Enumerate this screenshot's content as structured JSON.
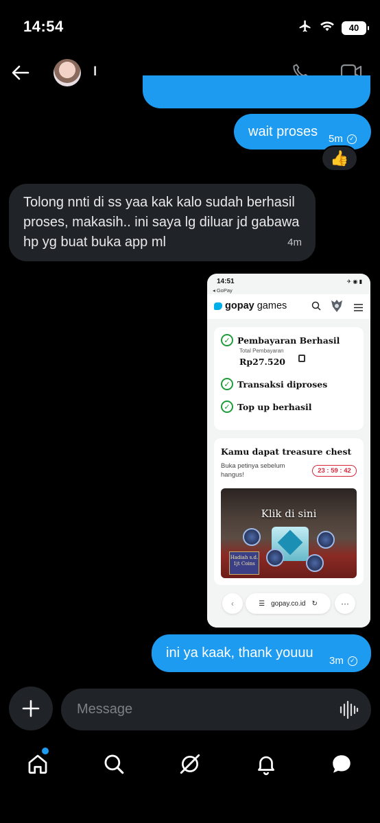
{
  "status_bar": {
    "time": "14:54",
    "battery": "40"
  },
  "header": {
    "contact_name": "I"
  },
  "messages": [
    {
      "direction": "out",
      "text": "wait proses",
      "time": "5m",
      "reaction": "👍"
    },
    {
      "direction": "in",
      "text": "Tolong nnti di ss yaa kak kalo sudah berhasil proses, makasih.. ini saya lg diluar jd gabawa hp yg buat buka app ml",
      "time": "4m"
    },
    {
      "direction": "out",
      "text": "ini ya kaak, thank youuu",
      "time": "3m"
    }
  ],
  "attachment": {
    "time": "14:51",
    "back_label": "◂ GoPay",
    "brand_bold": "gopay",
    "brand_rest": " games",
    "steps": [
      "Pembayaran Berhasil",
      "Transaksi diproses",
      "Top up berhasil"
    ],
    "total_label": "Total Pembayaran",
    "total_amount": "Rp27.520",
    "promo_title": "Kamu dapat treasure chest",
    "promo_desc": "Buka petinya sebelum hangus!",
    "timer": "23 : 59 : 42",
    "banner_cta": "Klik di sini",
    "banner_prize": "Hadiah s.d. 1jt Coins",
    "url": "gopay.co.id"
  },
  "composer": {
    "placeholder": "Message"
  },
  "colors": {
    "accent": "#1d9bf0",
    "bubble_in": "#202327",
    "success": "#1f9c3a",
    "timer": "#d6243a"
  }
}
